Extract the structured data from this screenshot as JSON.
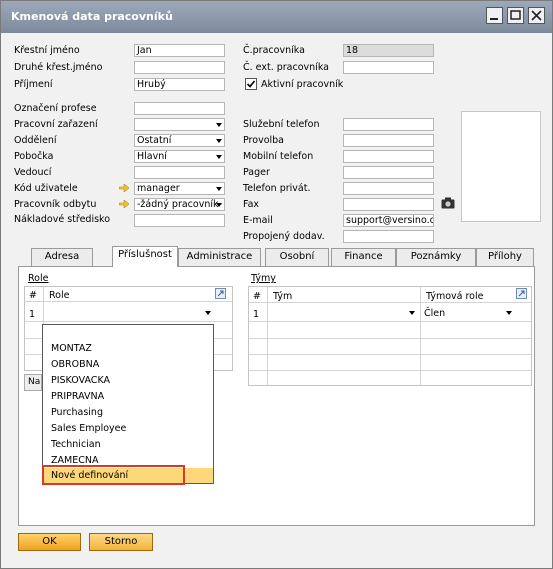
{
  "window": {
    "title": "Kmenová data pracovníků"
  },
  "left_form": [
    {
      "label": "Křestní jméno",
      "value": "Jan"
    },
    {
      "label": "Druhé křest.jméno",
      "value": ""
    },
    {
      "label": "Příjmení",
      "value": "Hrubý"
    }
  ],
  "left_form2": [
    {
      "label": "Označení profese",
      "value": ""
    },
    {
      "label": "Pracovní zařazení",
      "value": ""
    },
    {
      "label": "Oddělení",
      "value": "Ostatní"
    },
    {
      "label": "Pobočka",
      "value": "Hlavní"
    },
    {
      "label": "Vedoucí",
      "value": ""
    },
    {
      "label": "Kód uživatele",
      "value": "manager"
    },
    {
      "label": "Pracovník odbytu",
      "value": "-žádný pracovník-"
    },
    {
      "label": "Nákladové středisko",
      "value": ""
    }
  ],
  "right_form": {
    "employee_no_label": "Č.pracovníka",
    "employee_no_value": "18",
    "ext_no_label": "Č. ext. pracovníka",
    "ext_no_value": "",
    "active_label": "Aktivní pracovník",
    "active_checked": true
  },
  "right_form2": [
    {
      "label": "Služební telefon",
      "value": ""
    },
    {
      "label": "Provolba",
      "value": ""
    },
    {
      "label": "Mobilní telefon",
      "value": ""
    },
    {
      "label": "Pager",
      "value": ""
    },
    {
      "label": "Telefon privát.",
      "value": ""
    },
    {
      "label": "Fax",
      "value": ""
    },
    {
      "label": "E-mail",
      "value": "support@versino.cz"
    },
    {
      "label": "Propojený dodav.",
      "value": ""
    }
  ],
  "tabs": [
    "Adresa",
    "Příslušnost",
    "Administrace",
    "Osobní",
    "Finance",
    "Poznámky",
    "Přílohy"
  ],
  "active_tab": "Příslušnost",
  "role_section": {
    "title": "Role",
    "col_num": "#",
    "col_role": "Role",
    "row_num": "1",
    "row_value": "",
    "hidden_button_label": "Na"
  },
  "team_section": {
    "title": "Týmy",
    "col_num": "#",
    "col_team": "Tým",
    "col_team_role": "Týmová role",
    "row_num": "1",
    "row_team": "",
    "row_team_role": "Člen"
  },
  "role_dropdown": {
    "items": [
      "",
      "MONTAZ",
      "OBROBNA",
      "PISKOVACKA",
      "PRIPRAVNA",
      "Purchasing",
      "Sales Employee",
      "Technician",
      "ZAMECNA",
      "Nové definování"
    ],
    "highlighted": "Nové definování"
  },
  "buttons": {
    "ok": "OK",
    "cancel": "Storno"
  },
  "colors": {
    "accent": "#f3b43c",
    "highlight_box": "#d63a2e",
    "titlebar": "#8795a8"
  },
  "icons": [
    "window-minimize-icon",
    "window-maximize-icon",
    "window-close-icon",
    "link-arrow-icon",
    "camera-icon",
    "expand-grid-icon",
    "dropdown-arrow-icon"
  ]
}
